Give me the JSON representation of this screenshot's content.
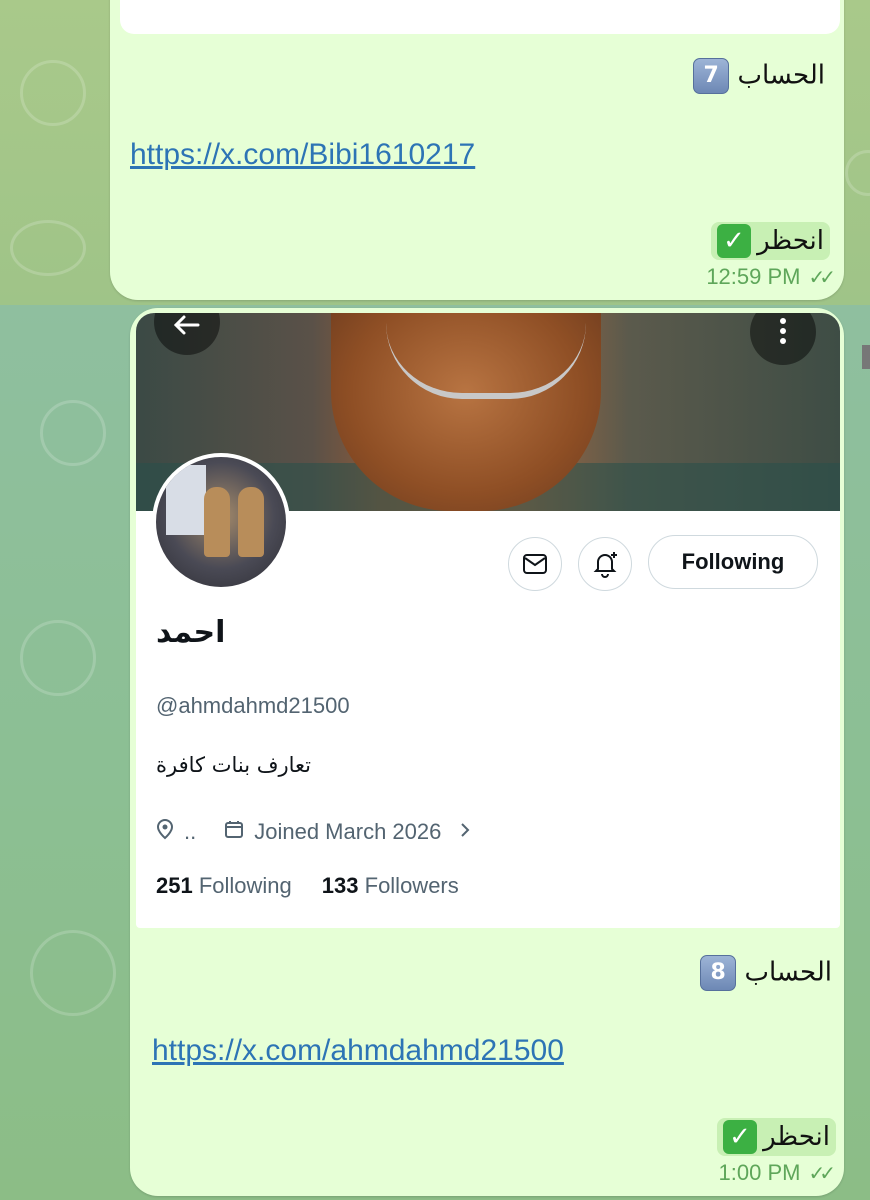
{
  "message_top": {
    "account_label": "الحساب",
    "account_number": "7",
    "link": "https://x.com/Bibi1610217",
    "block_label": "انحظر",
    "time": "12:59 PM"
  },
  "profile": {
    "name": "احمد",
    "handle": "@ahmdahmd21500",
    "bio": "تعارف بنات كافرة",
    "location": "..",
    "joined": "Joined March 2026",
    "following_count": "251",
    "following_label": "Following",
    "followers_count": "133",
    "followers_label": "Followers",
    "follow_button": "Following"
  },
  "message_bottom": {
    "account_label": "الحساب",
    "account_number": "8",
    "link": "https://x.com/ahmdahmd21500",
    "block_label": "انحظر",
    "time": "1:00 PM"
  },
  "colors": {
    "bubble": "#e6ffd6",
    "link": "#2d74b5",
    "time": "#5ea65a",
    "check": "#3cb043"
  }
}
